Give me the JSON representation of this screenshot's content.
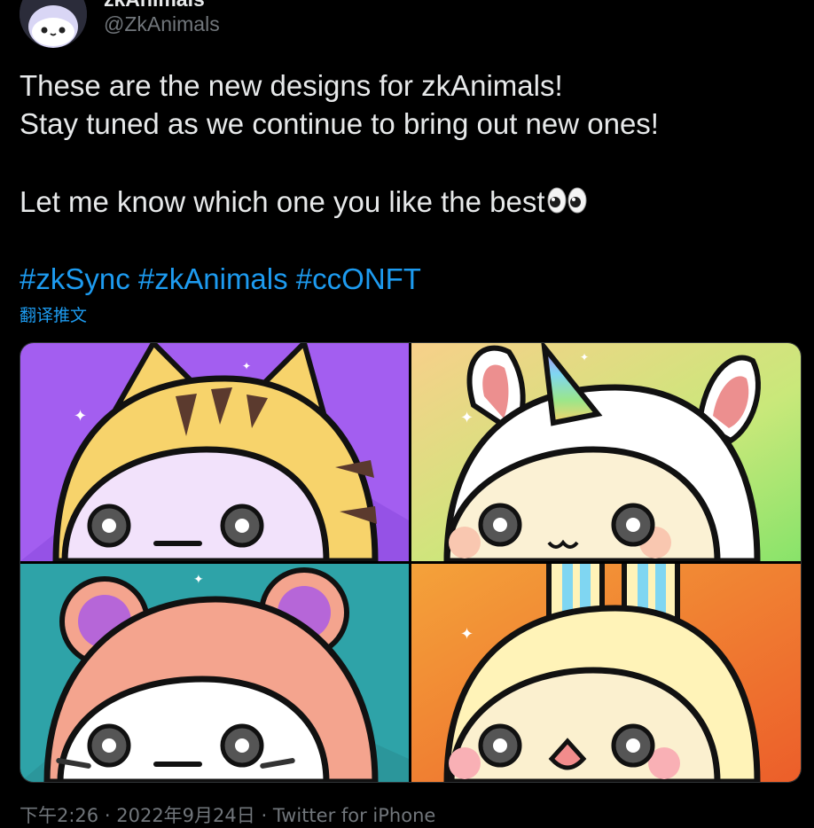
{
  "author": {
    "display_name": "zkAnimals",
    "handle": "@ZkAnimals"
  },
  "tweet": {
    "line1": "These are the new designs for zkAnimals!",
    "line2": "Stay tuned as we continue to bring out new ones!",
    "line3": "Let me know which one you like the best",
    "emoji": "eyes-emoji",
    "hashtags": [
      "#zkSync",
      "#zkAnimals",
      "#ccONFT"
    ],
    "translate_label": "翻译推文"
  },
  "media": {
    "tiles": [
      {
        "name": "tiger-animal",
        "bg": "#a35ef0"
      },
      {
        "name": "unicorn-animal",
        "bg": "#c9e87a"
      },
      {
        "name": "bear-animal",
        "bg": "#2ea3a8"
      },
      {
        "name": "bunny-animal",
        "bg": "#f08a33"
      }
    ]
  },
  "meta": {
    "time": "下午2:26",
    "separator": "·",
    "date": "2022年9月24日",
    "source": "Twitter for iPhone"
  },
  "colors": {
    "background": "#000000",
    "text": "#e7e9ea",
    "secondary": "#71767b",
    "link": "#1d9bf0"
  }
}
